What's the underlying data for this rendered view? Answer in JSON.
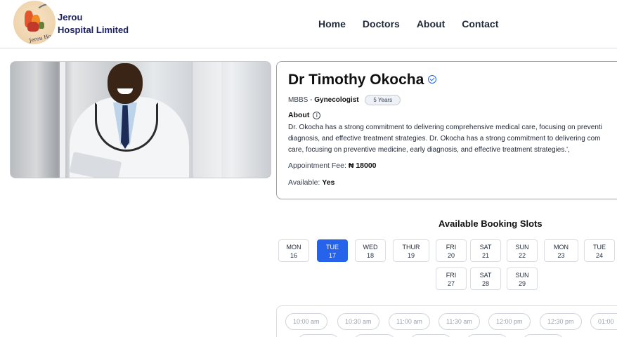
{
  "brand": {
    "line1": "Jerou",
    "line2": "Hospital Limited",
    "logo_text": "Jerou Hospital Ltd."
  },
  "nav": [
    "Home",
    "Doctors",
    "About",
    "Contact"
  ],
  "doctor": {
    "name": "Dr Timothy Okocha",
    "degree": "MBBS - ",
    "specialty": "Gynecologist",
    "experience": "5 Years",
    "about_heading": "About",
    "about_lines": [
      "Dr. Okocha has a strong commitment to delivering comprehensive medical care, focusing on preventi",
      "diagnosis, and effective treatment strategies. Dr. Okocha has a strong commitment to delivering com",
      "care, focusing on preventive medicine, early diagnosis, and effective treatment strategies.',"
    ],
    "fee_label": "Appointment Fee: ",
    "fee_value": "₦ 18000",
    "available_label": "Available: ",
    "available_value": "Yes"
  },
  "booking": {
    "title": "Available Booking Slots",
    "days": [
      {
        "day": "MON",
        "date": "16"
      },
      {
        "day": "TUE",
        "date": "17"
      },
      {
        "day": "WED",
        "date": "18"
      },
      {
        "day": "THUR",
        "date": "19"
      },
      {
        "day": "FRI",
        "date": "20"
      },
      {
        "day": "SAT",
        "date": "21"
      },
      {
        "day": "SUN",
        "date": "22"
      },
      {
        "day": "MON",
        "date": "23"
      },
      {
        "day": "TUE",
        "date": "24"
      },
      {
        "day": "FRI",
        "date": "27"
      },
      {
        "day": "SAT",
        "date": "28"
      },
      {
        "day": "SUN",
        "date": "29"
      }
    ],
    "selected_index": 1,
    "times": [
      "10:00 am",
      "10:30 am",
      "11:00 am",
      "11:30 am",
      "12:00 pm",
      "12:30 pm",
      "01:00"
    ]
  },
  "colors": {
    "accent": "#2563eb",
    "brand": "#1b1f5e"
  }
}
